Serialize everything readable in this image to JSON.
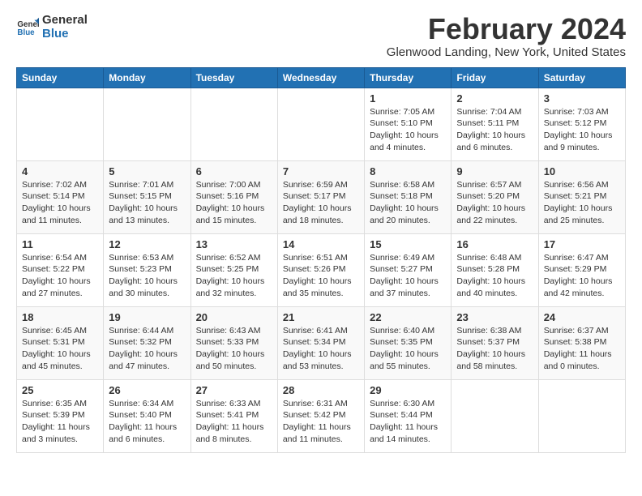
{
  "header": {
    "logo": {
      "line1": "General",
      "line2": "Blue"
    },
    "title": "February 2024",
    "location": "Glenwood Landing, New York, United States"
  },
  "calendar": {
    "weekdays": [
      "Sunday",
      "Monday",
      "Tuesday",
      "Wednesday",
      "Thursday",
      "Friday",
      "Saturday"
    ],
    "weeks": [
      [
        {
          "day": "",
          "info": ""
        },
        {
          "day": "",
          "info": ""
        },
        {
          "day": "",
          "info": ""
        },
        {
          "day": "",
          "info": ""
        },
        {
          "day": "1",
          "info": "Sunrise: 7:05 AM\nSunset: 5:10 PM\nDaylight: 10 hours\nand 4 minutes."
        },
        {
          "day": "2",
          "info": "Sunrise: 7:04 AM\nSunset: 5:11 PM\nDaylight: 10 hours\nand 6 minutes."
        },
        {
          "day": "3",
          "info": "Sunrise: 7:03 AM\nSunset: 5:12 PM\nDaylight: 10 hours\nand 9 minutes."
        }
      ],
      [
        {
          "day": "4",
          "info": "Sunrise: 7:02 AM\nSunset: 5:14 PM\nDaylight: 10 hours\nand 11 minutes."
        },
        {
          "day": "5",
          "info": "Sunrise: 7:01 AM\nSunset: 5:15 PM\nDaylight: 10 hours\nand 13 minutes."
        },
        {
          "day": "6",
          "info": "Sunrise: 7:00 AM\nSunset: 5:16 PM\nDaylight: 10 hours\nand 15 minutes."
        },
        {
          "day": "7",
          "info": "Sunrise: 6:59 AM\nSunset: 5:17 PM\nDaylight: 10 hours\nand 18 minutes."
        },
        {
          "day": "8",
          "info": "Sunrise: 6:58 AM\nSunset: 5:18 PM\nDaylight: 10 hours\nand 20 minutes."
        },
        {
          "day": "9",
          "info": "Sunrise: 6:57 AM\nSunset: 5:20 PM\nDaylight: 10 hours\nand 22 minutes."
        },
        {
          "day": "10",
          "info": "Sunrise: 6:56 AM\nSunset: 5:21 PM\nDaylight: 10 hours\nand 25 minutes."
        }
      ],
      [
        {
          "day": "11",
          "info": "Sunrise: 6:54 AM\nSunset: 5:22 PM\nDaylight: 10 hours\nand 27 minutes."
        },
        {
          "day": "12",
          "info": "Sunrise: 6:53 AM\nSunset: 5:23 PM\nDaylight: 10 hours\nand 30 minutes."
        },
        {
          "day": "13",
          "info": "Sunrise: 6:52 AM\nSunset: 5:25 PM\nDaylight: 10 hours\nand 32 minutes."
        },
        {
          "day": "14",
          "info": "Sunrise: 6:51 AM\nSunset: 5:26 PM\nDaylight: 10 hours\nand 35 minutes."
        },
        {
          "day": "15",
          "info": "Sunrise: 6:49 AM\nSunset: 5:27 PM\nDaylight: 10 hours\nand 37 minutes."
        },
        {
          "day": "16",
          "info": "Sunrise: 6:48 AM\nSunset: 5:28 PM\nDaylight: 10 hours\nand 40 minutes."
        },
        {
          "day": "17",
          "info": "Sunrise: 6:47 AM\nSunset: 5:29 PM\nDaylight: 10 hours\nand 42 minutes."
        }
      ],
      [
        {
          "day": "18",
          "info": "Sunrise: 6:45 AM\nSunset: 5:31 PM\nDaylight: 10 hours\nand 45 minutes."
        },
        {
          "day": "19",
          "info": "Sunrise: 6:44 AM\nSunset: 5:32 PM\nDaylight: 10 hours\nand 47 minutes."
        },
        {
          "day": "20",
          "info": "Sunrise: 6:43 AM\nSunset: 5:33 PM\nDaylight: 10 hours\nand 50 minutes."
        },
        {
          "day": "21",
          "info": "Sunrise: 6:41 AM\nSunset: 5:34 PM\nDaylight: 10 hours\nand 53 minutes."
        },
        {
          "day": "22",
          "info": "Sunrise: 6:40 AM\nSunset: 5:35 PM\nDaylight: 10 hours\nand 55 minutes."
        },
        {
          "day": "23",
          "info": "Sunrise: 6:38 AM\nSunset: 5:37 PM\nDaylight: 10 hours\nand 58 minutes."
        },
        {
          "day": "24",
          "info": "Sunrise: 6:37 AM\nSunset: 5:38 PM\nDaylight: 11 hours\nand 0 minutes."
        }
      ],
      [
        {
          "day": "25",
          "info": "Sunrise: 6:35 AM\nSunset: 5:39 PM\nDaylight: 11 hours\nand 3 minutes."
        },
        {
          "day": "26",
          "info": "Sunrise: 6:34 AM\nSunset: 5:40 PM\nDaylight: 11 hours\nand 6 minutes."
        },
        {
          "day": "27",
          "info": "Sunrise: 6:33 AM\nSunset: 5:41 PM\nDaylight: 11 hours\nand 8 minutes."
        },
        {
          "day": "28",
          "info": "Sunrise: 6:31 AM\nSunset: 5:42 PM\nDaylight: 11 hours\nand 11 minutes."
        },
        {
          "day": "29",
          "info": "Sunrise: 6:30 AM\nSunset: 5:44 PM\nDaylight: 11 hours\nand 14 minutes."
        },
        {
          "day": "",
          "info": ""
        },
        {
          "day": "",
          "info": ""
        }
      ]
    ]
  }
}
